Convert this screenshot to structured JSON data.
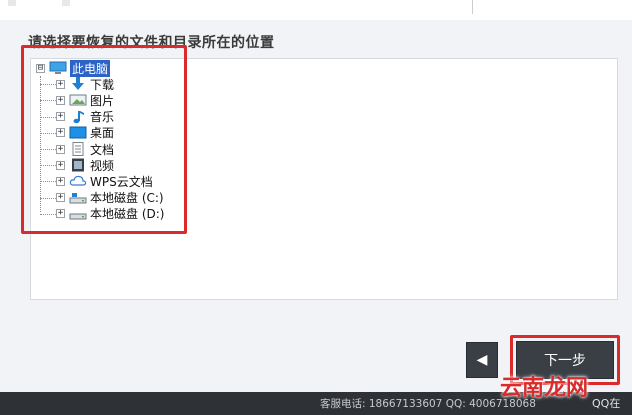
{
  "prompt": "请选择要恢复的文件和目录所在的位置",
  "tree": {
    "root": {
      "label": "此电脑",
      "expander": "⊟",
      "icon": "computer-icon"
    },
    "items": [
      {
        "label": "下载",
        "icon": "download-arrow-icon"
      },
      {
        "label": "图片",
        "icon": "picture-icon"
      },
      {
        "label": "音乐",
        "icon": "music-note-icon"
      },
      {
        "label": "桌面",
        "icon": "desktop-icon"
      },
      {
        "label": "文档",
        "icon": "document-icon"
      },
      {
        "label": "视频",
        "icon": "video-icon"
      },
      {
        "label": "WPS云文档",
        "icon": "cloud-icon"
      },
      {
        "label": "本地磁盘 (C:)",
        "icon": "drive-c-icon"
      },
      {
        "label": "本地磁盘 (D:)",
        "icon": "drive-d-icon"
      }
    ],
    "child_expander": "+"
  },
  "buttons": {
    "back_glyph": "◀",
    "next_label": "下一步"
  },
  "footer": {
    "text": "客服电话: 18667133607 QQ: 4006718068",
    "qq_label": "QQ在"
  },
  "watermark": "云南龙网",
  "colors": {
    "highlight": "#d92b2b",
    "selection": "#2b63c6",
    "footer_bg": "#2e3136",
    "button_bg": "#3a3f46"
  }
}
